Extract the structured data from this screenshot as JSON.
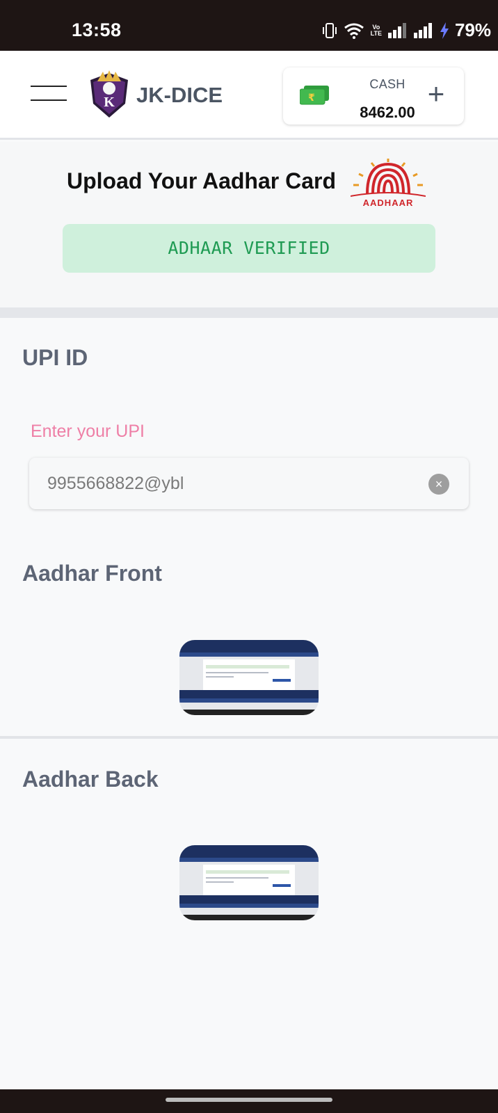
{
  "status_bar": {
    "time": "13:58",
    "volte_top": "Vo",
    "volte_bottom": "LTE",
    "battery": "79%"
  },
  "header": {
    "brand": "JK-DICE",
    "logo_letter": "K",
    "wallet": {
      "label": "CASH",
      "amount": "8462.00",
      "currency_symbol": "₹",
      "add_symbol": "+"
    }
  },
  "aadhar": {
    "title": "Upload Your Aadhar Card",
    "logo_text": "AADHAAR",
    "status": "ADHAAR VERIFIED"
  },
  "upi": {
    "heading": "UPI ID",
    "label": "Enter your UPI",
    "value": "9955668822@ybl",
    "clear_symbol": "×"
  },
  "documents": {
    "front_heading": "Aadhar Front",
    "back_heading": "Aadhar Back"
  },
  "colors": {
    "accent_pink": "#ee7fa6",
    "verified_bg": "#cff0dc",
    "verified_text": "#1f9b53",
    "heading_gray": "#5d6575"
  },
  "icons": [
    "menu-icon",
    "cash-icon",
    "add-icon",
    "clear-icon",
    "aadhaar-logo",
    "wifi-icon",
    "signal-icon",
    "battery-charging-icon",
    "vibrate-icon"
  ]
}
